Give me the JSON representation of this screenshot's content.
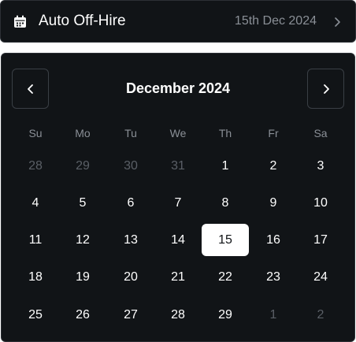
{
  "field": {
    "icon": "calendar-icon",
    "title": "Auto Off-Hire",
    "date": "15th Dec 2024",
    "chevron_icon": "chevron-right-icon"
  },
  "calendar": {
    "month_title": "December 2024",
    "prev_icon": "chevron-left-icon",
    "next_icon": "chevron-right-icon",
    "weekdays": [
      "Su",
      "Mo",
      "Tu",
      "We",
      "Th",
      "Fr",
      "Sa"
    ],
    "weeks": [
      [
        {
          "d": "28",
          "outside": true
        },
        {
          "d": "29",
          "outside": true
        },
        {
          "d": "30",
          "outside": true
        },
        {
          "d": "31",
          "outside": true
        },
        {
          "d": "1"
        },
        {
          "d": "2"
        },
        {
          "d": "3"
        }
      ],
      [
        {
          "d": "4"
        },
        {
          "d": "5"
        },
        {
          "d": "6"
        },
        {
          "d": "7"
        },
        {
          "d": "8"
        },
        {
          "d": "9"
        },
        {
          "d": "10"
        }
      ],
      [
        {
          "d": "11"
        },
        {
          "d": "12"
        },
        {
          "d": "13"
        },
        {
          "d": "14"
        },
        {
          "d": "15",
          "selected": true
        },
        {
          "d": "16"
        },
        {
          "d": "17"
        }
      ],
      [
        {
          "d": "18"
        },
        {
          "d": "19"
        },
        {
          "d": "20"
        },
        {
          "d": "21"
        },
        {
          "d": "22"
        },
        {
          "d": "23"
        },
        {
          "d": "24"
        }
      ],
      [
        {
          "d": "25"
        },
        {
          "d": "26"
        },
        {
          "d": "27"
        },
        {
          "d": "28"
        },
        {
          "d": "29"
        },
        {
          "d": "1",
          "outside": true
        },
        {
          "d": "2",
          "outside": true
        }
      ]
    ]
  },
  "colors": {
    "background": "#111417",
    "border": "#2c3035",
    "text": "#ffffff",
    "muted": "#8a8f96",
    "outside": "#5a5f66",
    "selected_bg": "#ffffff"
  }
}
